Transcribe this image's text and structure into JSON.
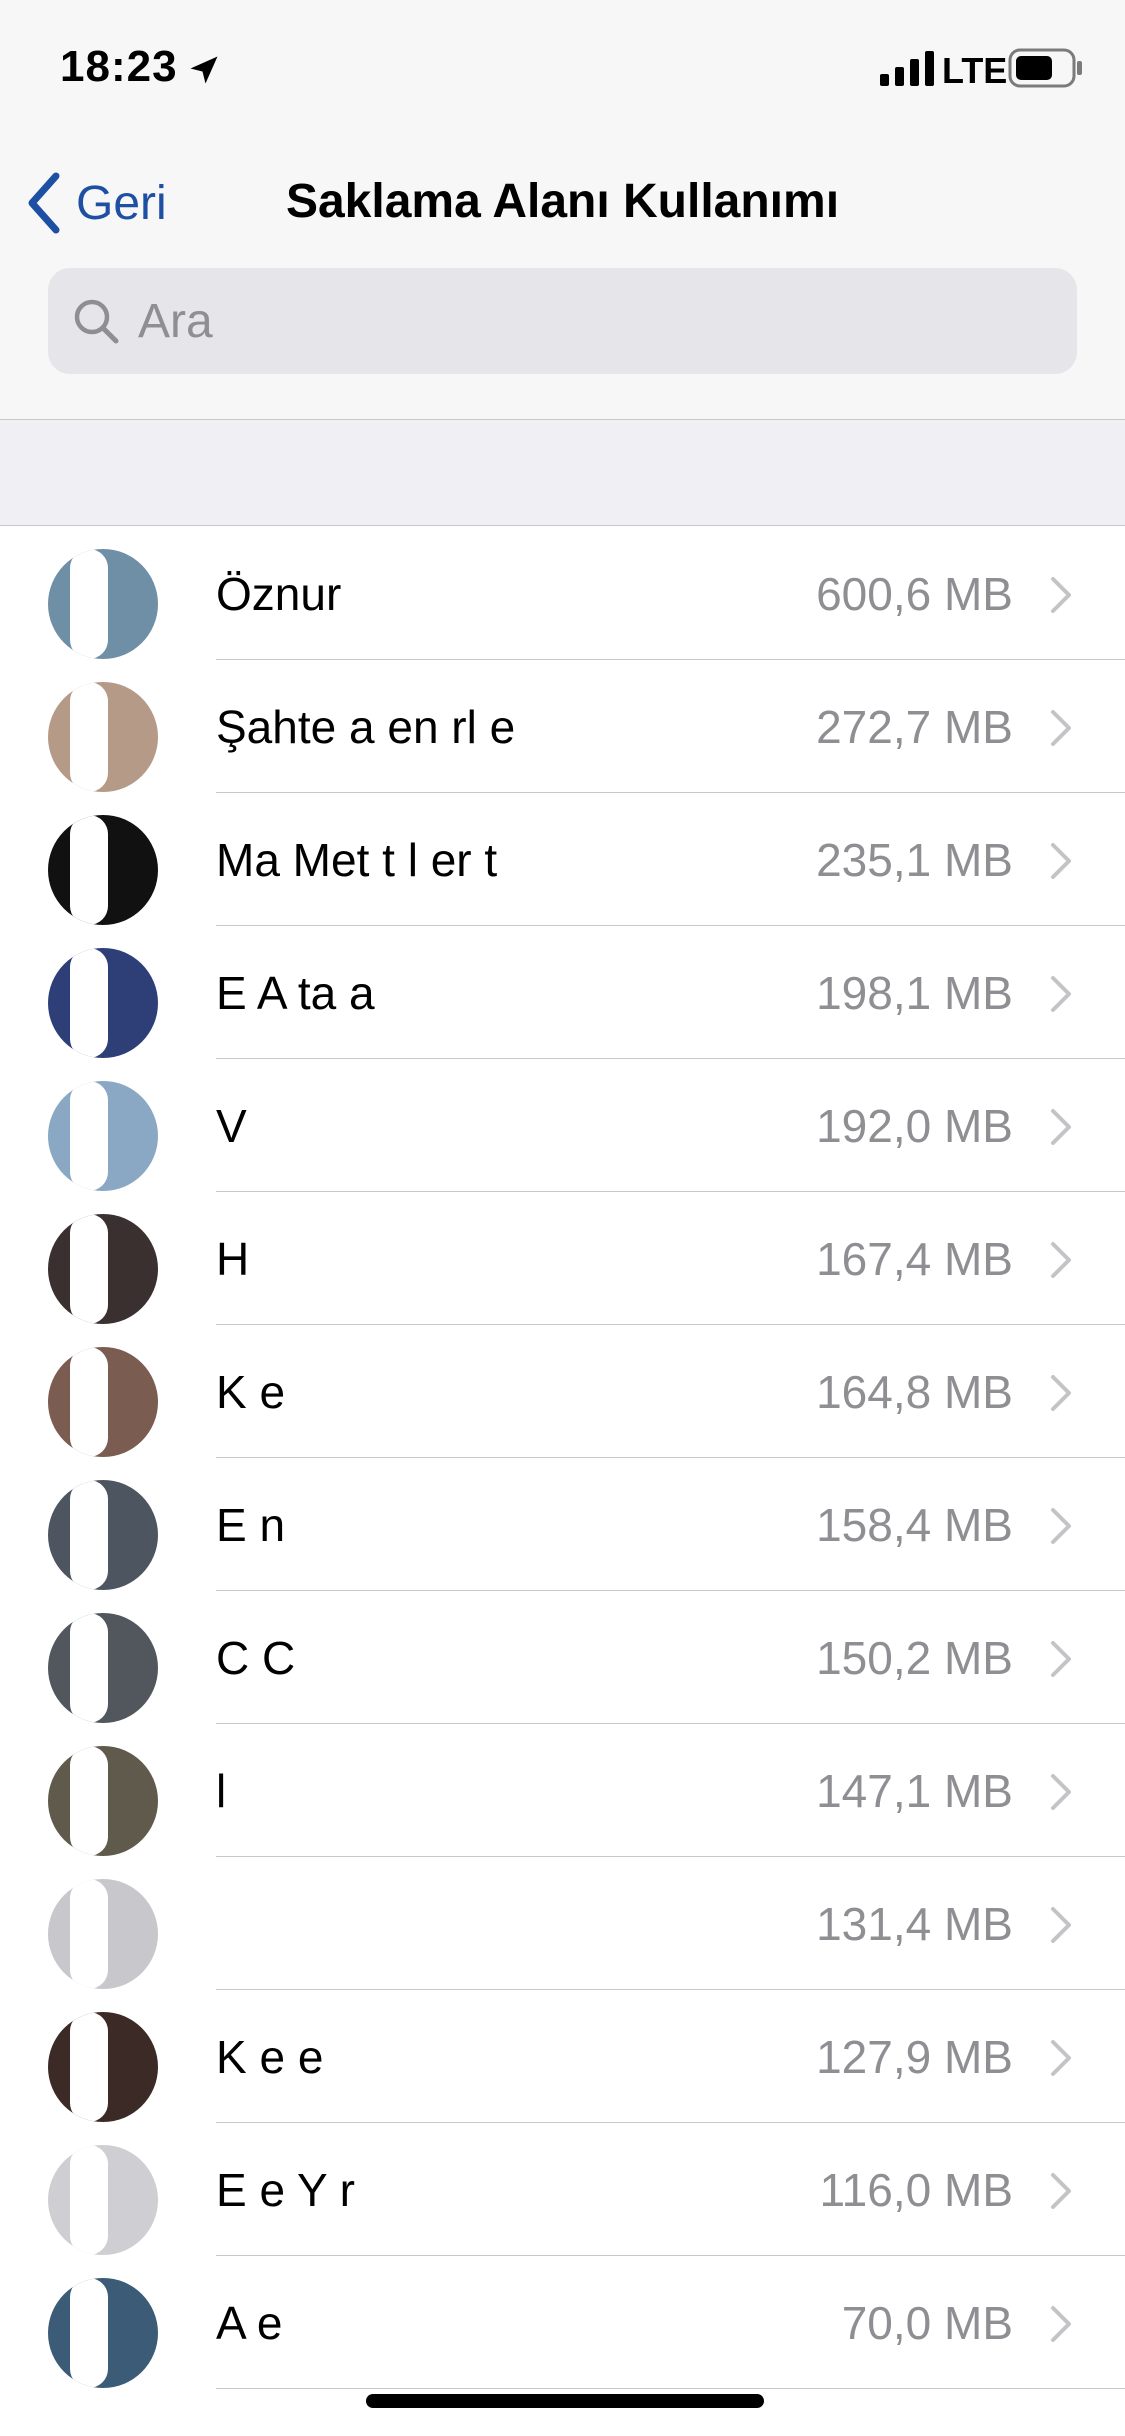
{
  "status_bar": {
    "time": "18:23",
    "network": "LTE"
  },
  "nav": {
    "back_label": "Geri",
    "title": "Saklama Alanı Kullanımı"
  },
  "search": {
    "placeholder": "Ara"
  },
  "contacts": [
    {
      "name": "Öznur",
      "size": "600,6 MB",
      "avatar_color": "#6f8fa6"
    },
    {
      "name": "Şahte a  en rl e",
      "size": "272,7 MB",
      "avatar_color": "#b59a88"
    },
    {
      "name": "Ma  Met t  l  er t",
      "size": "235,1 MB",
      "avatar_color": "#111111"
    },
    {
      "name": "E  A  ta a",
      "size": "198,1 MB",
      "avatar_color": "#2e3f78"
    },
    {
      "name": "V",
      "size": "192,0 MB",
      "avatar_color": "#8aa8c4"
    },
    {
      "name": "H",
      "size": "167,4 MB",
      "avatar_color": "#3a3030"
    },
    {
      "name": "K  e",
      "size": "164,8 MB",
      "avatar_color": "#7a5c50"
    },
    {
      "name": "E  n",
      "size": "158,4 MB",
      "avatar_color": "#4d5560"
    },
    {
      "name": "C  C",
      "size": "150,2 MB",
      "avatar_color": "#52575e"
    },
    {
      "name": "l",
      "size": "147,1 MB",
      "avatar_color": "#5f5a4c"
    },
    {
      "name": "",
      "size": "131,4 MB",
      "avatar_color": "#c7c7cc"
    },
    {
      "name": "K  e  e",
      "size": "127,9 MB",
      "avatar_color": "#3b2a26"
    },
    {
      "name": "E  e Y  r",
      "size": "116,0 MB",
      "avatar_color": "#cfcfd3"
    },
    {
      "name": "A  e",
      "size": "70,0 MB",
      "avatar_color": "#3c5b77"
    }
  ],
  "colors": {
    "accent": "#1d4fa3",
    "secondary_text": "#8e8e93",
    "separator": "#c8c8cc",
    "search_bg": "#e5e5ea",
    "section_bg": "#efeff4"
  }
}
